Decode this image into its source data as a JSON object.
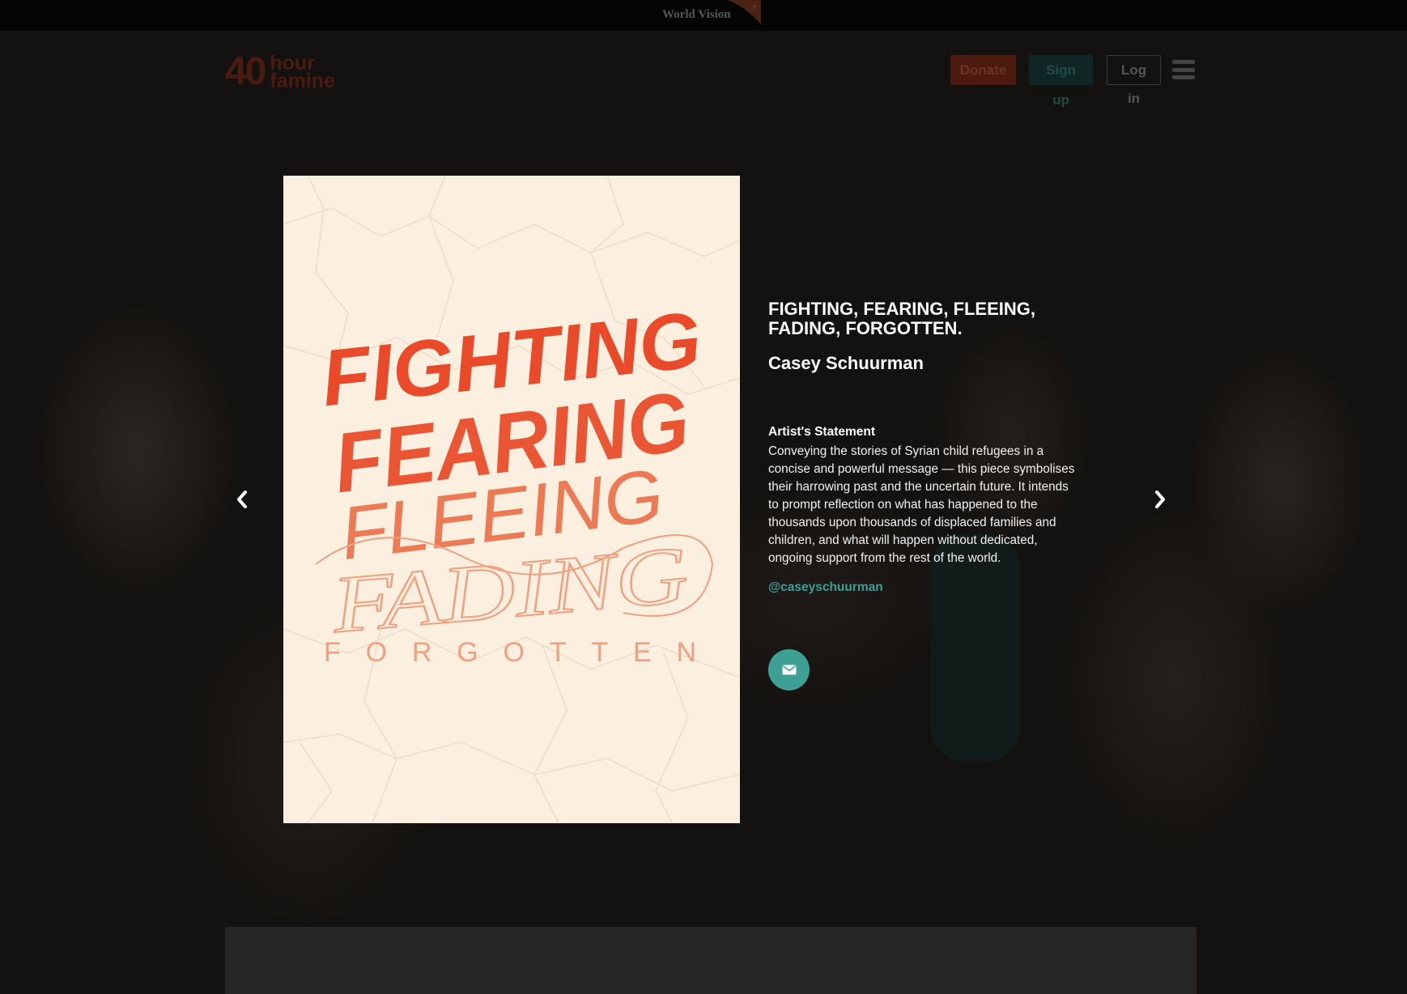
{
  "topbar": {
    "logo_text": "World Vision"
  },
  "header": {
    "brand_number": "40",
    "brand_line1": "hour",
    "brand_line2": "famine",
    "donate_label": "Donate",
    "signup_label": "Sign up",
    "login_label": "Log in"
  },
  "artwork": {
    "lines": [
      "FIGHTING",
      "FEARING",
      "FLEEING",
      "FADING",
      "FORGOTTEN"
    ]
  },
  "detail": {
    "title": "FIGHTING, FEARING, FLEEING, FADING, FORGOTTEN.",
    "artist": "Casey Schuurman",
    "statement_label": "Artist's Statement",
    "statement": "Conveying the stories of Syrian child refugees in a concise and powerful message — this piece symbolises their harrowing past and the uncertain future. It intends to prompt reflection on what has happened to the thousands upon thousands of displaced families and children, and what will happen without dedicated, ongoing support from the rest of the world.",
    "handle": "@caseyschuurman"
  },
  "colors": {
    "accent_teal": "#3e9f95",
    "artwork_red": "#e84a2a",
    "artwork_bg": "#fbefe0"
  }
}
